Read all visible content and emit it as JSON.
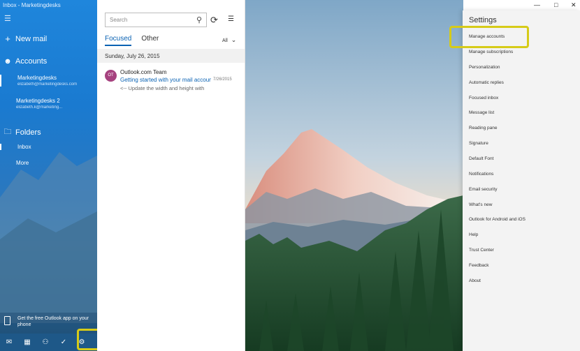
{
  "window": {
    "title": "Inbox - Marketingdesks"
  },
  "nav": {
    "new_mail": "New mail",
    "accounts_label": "Accounts",
    "accounts": [
      {
        "name": "Marketingdesks",
        "email": "elizabeth@marketingdesks.com"
      },
      {
        "name": "Marketingdesks 2",
        "email": "elizabeth.k@marketing..."
      }
    ],
    "folders_label": "Folders",
    "inbox_label": "Inbox",
    "more_label": "More",
    "promo_text": "Get the free Outlook app on your phone"
  },
  "list": {
    "search_placeholder": "Search",
    "tab_focused": "Focused",
    "tab_other": "Other",
    "filter_label": "All",
    "date_header": "Sunday, July 26, 2015",
    "message": {
      "avatar_initials": "OT",
      "from": "Outlook.com Team",
      "subject": "Getting started with your mail account",
      "date": "7/26/2015",
      "preview": "<-- Update the width and height with"
    }
  },
  "settings": {
    "title": "Settings",
    "items": [
      "Manage accounts",
      "Manage subscriptions",
      "Personalization",
      "Automatic replies",
      "Focused inbox",
      "Message list",
      "Reading pane",
      "Signature",
      "Default Font",
      "Notifications",
      "Email security",
      "What's new",
      "Outlook for Android and iOS",
      "Help",
      "Trust Center",
      "Feedback",
      "About"
    ]
  },
  "colors": {
    "accent": "#0a62b3",
    "highlight": "#d6cb18",
    "nav_blue": "#1f86dc"
  }
}
